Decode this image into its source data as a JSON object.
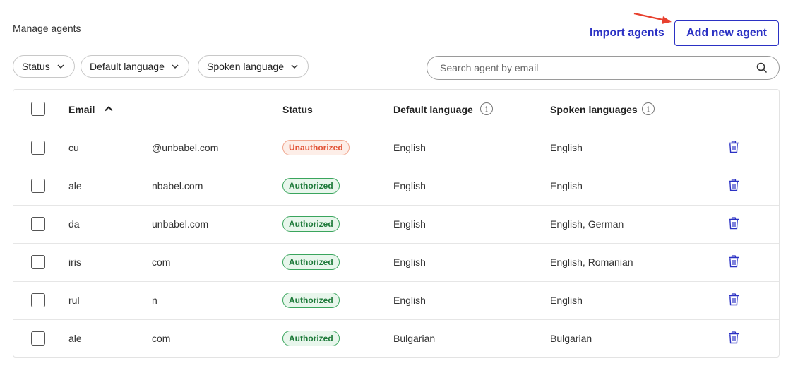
{
  "header": {
    "section_title": "Manage agents",
    "import_label": "Import agents",
    "add_label": "Add new agent"
  },
  "filters": [
    {
      "label": "Status"
    },
    {
      "label": "Default language"
    },
    {
      "label": "Spoken language"
    }
  ],
  "search": {
    "placeholder": "Search agent by email"
  },
  "table": {
    "columns": {
      "email": "Email",
      "status": "Status",
      "default_language": "Default language",
      "spoken_languages": "Spoken languages"
    },
    "rows": [
      {
        "email_start": "cu",
        "email_end": "@unbabel.com",
        "status": "Unauthorized",
        "default_language": "English",
        "spoken_languages": "English"
      },
      {
        "email_start": "ale",
        "email_end": "nbabel.com",
        "status": "Authorized",
        "default_language": "English",
        "spoken_languages": "English"
      },
      {
        "email_start": "da",
        "email_end": "unbabel.com",
        "status": "Authorized",
        "default_language": "English",
        "spoken_languages": "English, German"
      },
      {
        "email_start": "iris",
        "email_end": "com",
        "status": "Authorized",
        "default_language": "English",
        "spoken_languages": "English, Romanian"
      },
      {
        "email_start": "rul",
        "email_end": "n",
        "status": "Authorized",
        "default_language": "English",
        "spoken_languages": "English"
      },
      {
        "email_start": "ale",
        "email_end": "com",
        "status": "Authorized",
        "default_language": "Bulgarian",
        "spoken_languages": "Bulgarian"
      }
    ]
  },
  "colors": {
    "accent": "#2b31c4",
    "authorized": "#1e7a3a",
    "unauthorized": "#e2563a",
    "annotation_arrow": "#e8402e"
  },
  "icons": [
    "chevron-down-icon",
    "search-icon",
    "chevron-up-icon",
    "info-icon",
    "trash-icon",
    "arrow-annotation"
  ]
}
